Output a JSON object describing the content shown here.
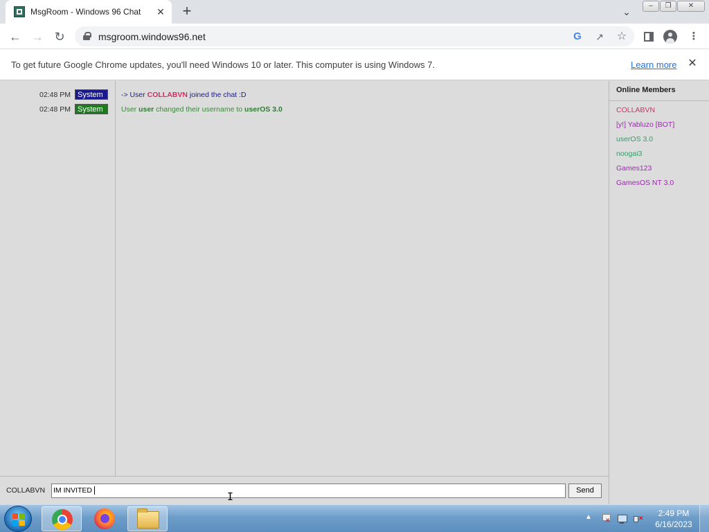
{
  "browser": {
    "tab_title": "MsgRoom - Windows 96 Chat",
    "tab_close": "✕",
    "new_tab": "+",
    "url": "msgroom.windows96.net"
  },
  "infobar": {
    "message": "To get future Google Chrome updates, you'll need Windows 10 or later. This computer is using Windows 7.",
    "learn_more": "Learn more",
    "close": "✕"
  },
  "chat": {
    "messages": [
      {
        "time": "02:48 PM",
        "badge": "System",
        "badge_color": "#1a1a8c",
        "text_color": "#1a1a8c",
        "parts": [
          "-> User ",
          "COLLABVN",
          " joined the chat :D"
        ],
        "highlight_color": "#d0306a"
      },
      {
        "time": "02:48 PM",
        "badge": "System",
        "badge_color": "#1e7a1e",
        "text_color": "#3a8a3a",
        "parts": [
          "User ",
          "user",
          " changed their username to ",
          "userOS 3.0"
        ],
        "highlight_color": "#2e7d32"
      }
    ]
  },
  "members": {
    "title": "Online Members",
    "list": [
      {
        "name": "COLLABVN",
        "color": "#d0306a"
      },
      {
        "name": "[y!] Yabluzo [BOT]",
        "color": "#9c27b0"
      },
      {
        "name": "userOS 3.0",
        "color": "#3a9a6a"
      },
      {
        "name": "noogai3",
        "color": "#3a9a6a"
      },
      {
        "name": "Games123",
        "color": "#9c27b0"
      },
      {
        "name": "GamesOS NT 3.0",
        "color": "#9c27b0"
      }
    ]
  },
  "composer": {
    "nickname": "COLLABVN",
    "input_value": "IM INVITED",
    "send_label": "Send"
  },
  "taskbar": {
    "time": "2:49 PM",
    "date": "6/16/2023"
  }
}
